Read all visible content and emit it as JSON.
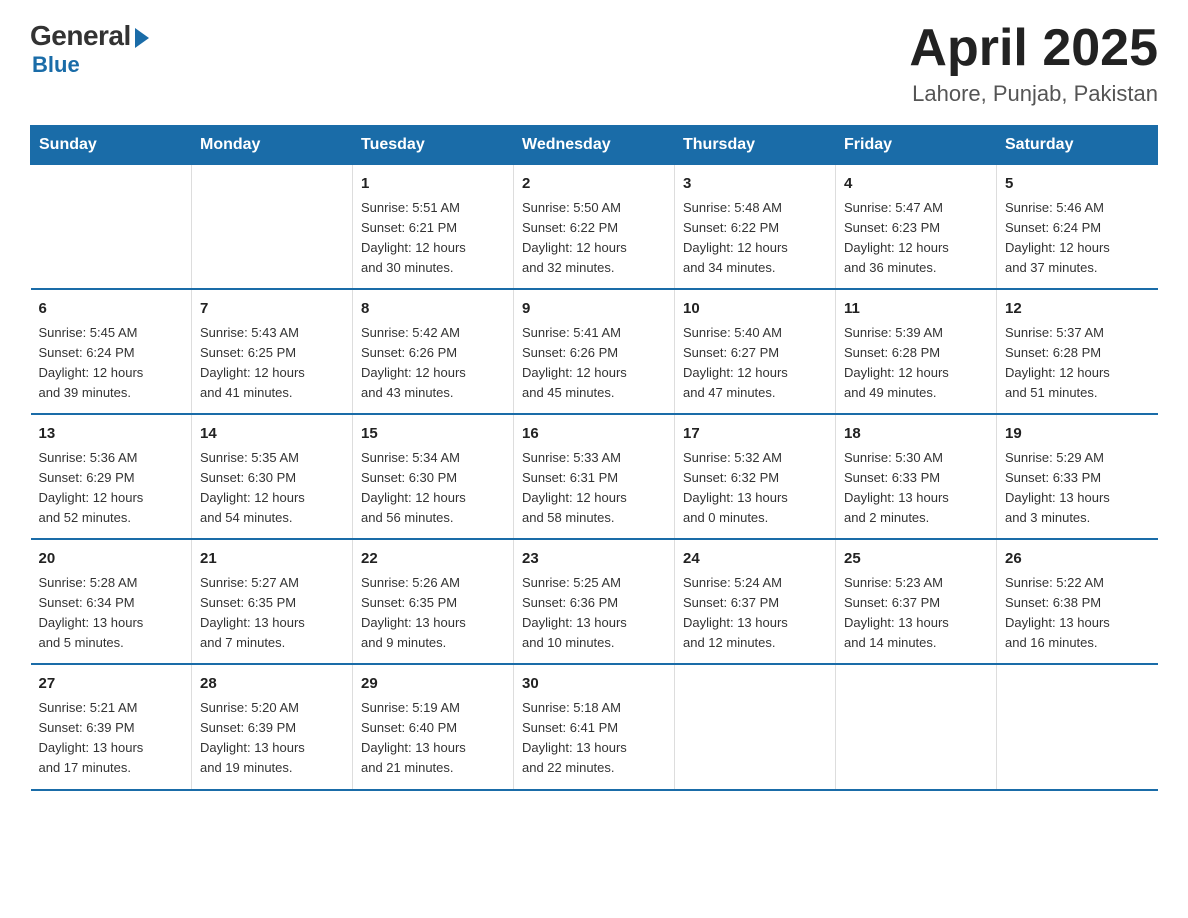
{
  "logo": {
    "general": "General",
    "blue": "Blue"
  },
  "title": {
    "month_year": "April 2025",
    "location": "Lahore, Punjab, Pakistan"
  },
  "days_of_week": [
    "Sunday",
    "Monday",
    "Tuesday",
    "Wednesday",
    "Thursday",
    "Friday",
    "Saturday"
  ],
  "weeks": [
    [
      {
        "day": "",
        "info": ""
      },
      {
        "day": "",
        "info": ""
      },
      {
        "day": "1",
        "info": "Sunrise: 5:51 AM\nSunset: 6:21 PM\nDaylight: 12 hours\nand 30 minutes."
      },
      {
        "day": "2",
        "info": "Sunrise: 5:50 AM\nSunset: 6:22 PM\nDaylight: 12 hours\nand 32 minutes."
      },
      {
        "day": "3",
        "info": "Sunrise: 5:48 AM\nSunset: 6:22 PM\nDaylight: 12 hours\nand 34 minutes."
      },
      {
        "day": "4",
        "info": "Sunrise: 5:47 AM\nSunset: 6:23 PM\nDaylight: 12 hours\nand 36 minutes."
      },
      {
        "day": "5",
        "info": "Sunrise: 5:46 AM\nSunset: 6:24 PM\nDaylight: 12 hours\nand 37 minutes."
      }
    ],
    [
      {
        "day": "6",
        "info": "Sunrise: 5:45 AM\nSunset: 6:24 PM\nDaylight: 12 hours\nand 39 minutes."
      },
      {
        "day": "7",
        "info": "Sunrise: 5:43 AM\nSunset: 6:25 PM\nDaylight: 12 hours\nand 41 minutes."
      },
      {
        "day": "8",
        "info": "Sunrise: 5:42 AM\nSunset: 6:26 PM\nDaylight: 12 hours\nand 43 minutes."
      },
      {
        "day": "9",
        "info": "Sunrise: 5:41 AM\nSunset: 6:26 PM\nDaylight: 12 hours\nand 45 minutes."
      },
      {
        "day": "10",
        "info": "Sunrise: 5:40 AM\nSunset: 6:27 PM\nDaylight: 12 hours\nand 47 minutes."
      },
      {
        "day": "11",
        "info": "Sunrise: 5:39 AM\nSunset: 6:28 PM\nDaylight: 12 hours\nand 49 minutes."
      },
      {
        "day": "12",
        "info": "Sunrise: 5:37 AM\nSunset: 6:28 PM\nDaylight: 12 hours\nand 51 minutes."
      }
    ],
    [
      {
        "day": "13",
        "info": "Sunrise: 5:36 AM\nSunset: 6:29 PM\nDaylight: 12 hours\nand 52 minutes."
      },
      {
        "day": "14",
        "info": "Sunrise: 5:35 AM\nSunset: 6:30 PM\nDaylight: 12 hours\nand 54 minutes."
      },
      {
        "day": "15",
        "info": "Sunrise: 5:34 AM\nSunset: 6:30 PM\nDaylight: 12 hours\nand 56 minutes."
      },
      {
        "day": "16",
        "info": "Sunrise: 5:33 AM\nSunset: 6:31 PM\nDaylight: 12 hours\nand 58 minutes."
      },
      {
        "day": "17",
        "info": "Sunrise: 5:32 AM\nSunset: 6:32 PM\nDaylight: 13 hours\nand 0 minutes."
      },
      {
        "day": "18",
        "info": "Sunrise: 5:30 AM\nSunset: 6:33 PM\nDaylight: 13 hours\nand 2 minutes."
      },
      {
        "day": "19",
        "info": "Sunrise: 5:29 AM\nSunset: 6:33 PM\nDaylight: 13 hours\nand 3 minutes."
      }
    ],
    [
      {
        "day": "20",
        "info": "Sunrise: 5:28 AM\nSunset: 6:34 PM\nDaylight: 13 hours\nand 5 minutes."
      },
      {
        "day": "21",
        "info": "Sunrise: 5:27 AM\nSunset: 6:35 PM\nDaylight: 13 hours\nand 7 minutes."
      },
      {
        "day": "22",
        "info": "Sunrise: 5:26 AM\nSunset: 6:35 PM\nDaylight: 13 hours\nand 9 minutes."
      },
      {
        "day": "23",
        "info": "Sunrise: 5:25 AM\nSunset: 6:36 PM\nDaylight: 13 hours\nand 10 minutes."
      },
      {
        "day": "24",
        "info": "Sunrise: 5:24 AM\nSunset: 6:37 PM\nDaylight: 13 hours\nand 12 minutes."
      },
      {
        "day": "25",
        "info": "Sunrise: 5:23 AM\nSunset: 6:37 PM\nDaylight: 13 hours\nand 14 minutes."
      },
      {
        "day": "26",
        "info": "Sunrise: 5:22 AM\nSunset: 6:38 PM\nDaylight: 13 hours\nand 16 minutes."
      }
    ],
    [
      {
        "day": "27",
        "info": "Sunrise: 5:21 AM\nSunset: 6:39 PM\nDaylight: 13 hours\nand 17 minutes."
      },
      {
        "day": "28",
        "info": "Sunrise: 5:20 AM\nSunset: 6:39 PM\nDaylight: 13 hours\nand 19 minutes."
      },
      {
        "day": "29",
        "info": "Sunrise: 5:19 AM\nSunset: 6:40 PM\nDaylight: 13 hours\nand 21 minutes."
      },
      {
        "day": "30",
        "info": "Sunrise: 5:18 AM\nSunset: 6:41 PM\nDaylight: 13 hours\nand 22 minutes."
      },
      {
        "day": "",
        "info": ""
      },
      {
        "day": "",
        "info": ""
      },
      {
        "day": "",
        "info": ""
      }
    ]
  ]
}
